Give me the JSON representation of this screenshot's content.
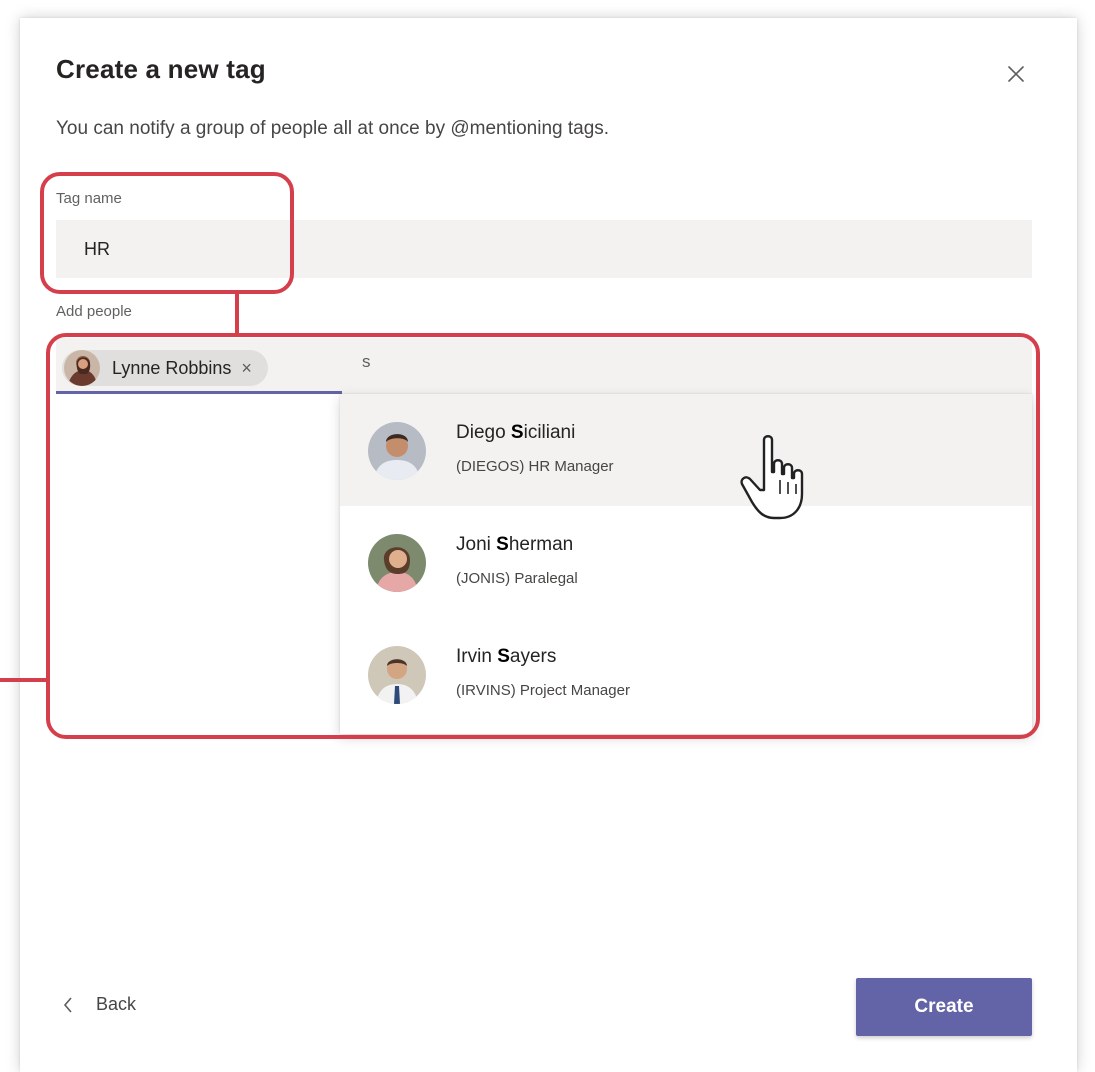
{
  "dialog": {
    "title": "Create a new tag",
    "subtitle": "You can notify a group of people all at once by @mentioning tags."
  },
  "tag_name": {
    "label": "Tag name",
    "value": "HR"
  },
  "add_people": {
    "label": "Add people",
    "selected_chip": {
      "name": "Lynne Robbins",
      "remove_glyph": "×"
    },
    "query": "s"
  },
  "suggestions": [
    {
      "name_pre": "Diego ",
      "name_match": "S",
      "name_post": "iciliani",
      "detail": "(DIEGOS) HR Manager",
      "highlighted": true
    },
    {
      "name_pre": "Joni ",
      "name_match": "S",
      "name_post": "herman",
      "detail": "(JONIS) Paralegal",
      "highlighted": false
    },
    {
      "name_pre": "Irvin ",
      "name_match": "S",
      "name_post": "ayers",
      "detail": "(IRVINS) Project Manager",
      "highlighted": false
    }
  ],
  "footer": {
    "back_label": "Back",
    "create_label": "Create"
  },
  "icons": {
    "close": "close-icon",
    "back": "chevron-left-icon",
    "cursor": "hand-pointer-icon"
  },
  "colors": {
    "accent": "#6264a7",
    "annotation": "#d43f4b",
    "input_background": "#f3f2f1"
  }
}
